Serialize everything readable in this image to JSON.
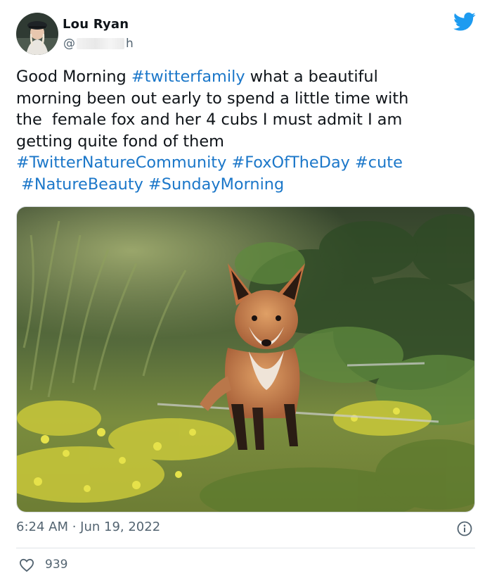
{
  "author": {
    "name": "Lou Ryan",
    "handle_prefix": "@",
    "handle_suffix": "h"
  },
  "tweet": {
    "segments": [
      {
        "text": "Good Morning ",
        "tag": false
      },
      {
        "text": "#twitterfamily",
        "tag": true
      },
      {
        "text": " what a beautiful\nmorning been out early to spend a little time with\nthe  female fox and her 4 cubs I must admit I am\ngetting quite fond of them\n",
        "tag": false
      },
      {
        "text": "#TwitterNatureCommunity",
        "tag": true
      },
      {
        "text": " ",
        "tag": false
      },
      {
        "text": "#FoxOfTheDay",
        "tag": true
      },
      {
        "text": " ",
        "tag": false
      },
      {
        "text": "#cute",
        "tag": true
      },
      {
        "text": "\n ",
        "tag": false
      },
      {
        "text": "#NatureBeauty",
        "tag": true
      },
      {
        "text": " ",
        "tag": false
      },
      {
        "text": "#SundayMorning",
        "tag": true
      }
    ]
  },
  "timestamp": "6:24 AM · Jun 19, 2022",
  "likes": "939",
  "colors": {
    "hashtag": "#1b77c9",
    "twitter_blue": "#1d9bf0",
    "muted": "#536471"
  },
  "icons": {
    "brand": "twitter-bird-icon",
    "info": "info-icon",
    "like": "heart-icon"
  }
}
